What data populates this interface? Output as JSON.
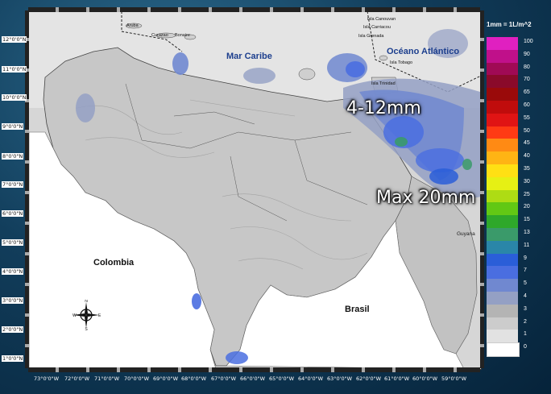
{
  "map": {
    "sea_label": "Mar Caribe",
    "ocean_label": "Océano Atlántico",
    "country_colombia": "Colombia",
    "country_brasil": "Brasil",
    "country_guyana": "Guyana",
    "islands": {
      "aruba": "Aruba",
      "curazao": "Curazao",
      "bonaire": "Bonaire",
      "canouvan": "Isla Canouvan",
      "carriacou": "Isla Carriacou",
      "grenada": "Isla Grenada",
      "tobago": "Isla Tobago",
      "trinidad": "Isla Trinidad"
    },
    "overlay_range": "4-12mm",
    "overlay_max": "Max 20mm",
    "compass": {
      "n": "N",
      "s": "S",
      "e": "E",
      "w": "W"
    }
  },
  "axes": {
    "latitude": [
      "12°0'0\"N",
      "11°0'0\"N",
      "10°0'0\"N",
      "9°0'0\"N",
      "8°0'0\"N",
      "7°0'0\"N",
      "6°0'0\"N",
      "5°0'0\"N",
      "4°0'0\"N",
      "3°0'0\"N",
      "2°0'0\"N",
      "1°0'0\"N"
    ],
    "longitude": [
      "73°0'0\"W",
      "72°0'0\"W",
      "71°0'0\"W",
      "70°0'0\"W",
      "69°0'0\"W",
      "68°0'0\"W",
      "67°0'0\"W",
      "66°0'0\"W",
      "65°0'0\"W",
      "64°0'0\"W",
      "63°0'0\"W",
      "62°0'0\"W",
      "61°0'0\"W",
      "60°0'0\"W",
      "59°0'0\"W"
    ]
  },
  "legend": {
    "title": "1mm = 1L/m^2",
    "items": [
      {
        "value": "100",
        "color": "#e020c0"
      },
      {
        "value": "90",
        "color": "#c0108a"
      },
      {
        "value": "80",
        "color": "#a00a55"
      },
      {
        "value": "70",
        "color": "#8a0a2a"
      },
      {
        "value": "65",
        "color": "#9a0a0a"
      },
      {
        "value": "60",
        "color": "#c00c0c"
      },
      {
        "value": "55",
        "color": "#e01414"
      },
      {
        "value": "50",
        "color": "#ff3a14"
      },
      {
        "value": "45",
        "color": "#ff8a14"
      },
      {
        "value": "40",
        "color": "#ffb414"
      },
      {
        "value": "35",
        "color": "#ffe014"
      },
      {
        "value": "30",
        "color": "#e6f014"
      },
      {
        "value": "25",
        "color": "#aedc14"
      },
      {
        "value": "20",
        "color": "#62c814"
      },
      {
        "value": "15",
        "color": "#2ea82a"
      },
      {
        "value": "13",
        "color": "#3a9a6a"
      },
      {
        "value": "11",
        "color": "#2a86a8"
      },
      {
        "value": "9",
        "color": "#2a5ed8"
      },
      {
        "value": "7",
        "color": "#4a6ee0"
      },
      {
        "value": "5",
        "color": "#7088d0"
      },
      {
        "value": "4",
        "color": "#94a0c4"
      },
      {
        "value": "3",
        "color": "#b4b4b4"
      },
      {
        "value": "2",
        "color": "#cccccc"
      },
      {
        "value": "1",
        "color": "#e2e2e2"
      },
      {
        "value": "0",
        "color": "#ffffff"
      }
    ]
  }
}
